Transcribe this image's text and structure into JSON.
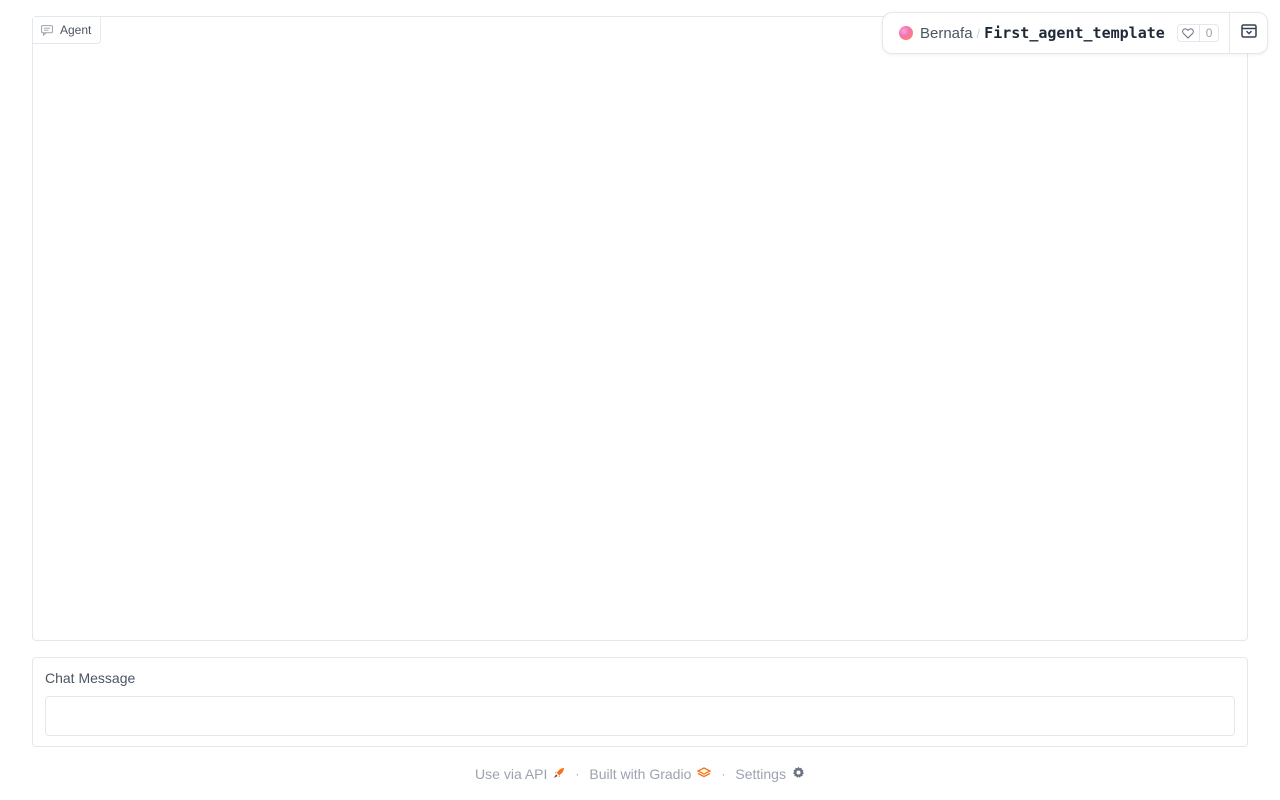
{
  "chatbot": {
    "label": "Agent",
    "label_icon": "chat-icon"
  },
  "space_header": {
    "owner": "Bernafa",
    "separator": "/",
    "space_name": "First_agent_template",
    "likes": "0",
    "like_icon": "heart-icon",
    "collapse_icon": "collapse-icon"
  },
  "message": {
    "label": "Chat Message",
    "value": "",
    "placeholder": ""
  },
  "footer": {
    "api_label": "Use via API",
    "api_icon": "rocket-icon",
    "separator": "·",
    "gradio_label": "Built with Gradio",
    "gradio_icon": "gradio-logo-icon",
    "settings_label": "Settings",
    "settings_icon": "gear-icon"
  },
  "colors": {
    "border": "#e5e7eb",
    "muted_text": "#9ca3af",
    "accent_orange": "#f97316"
  }
}
